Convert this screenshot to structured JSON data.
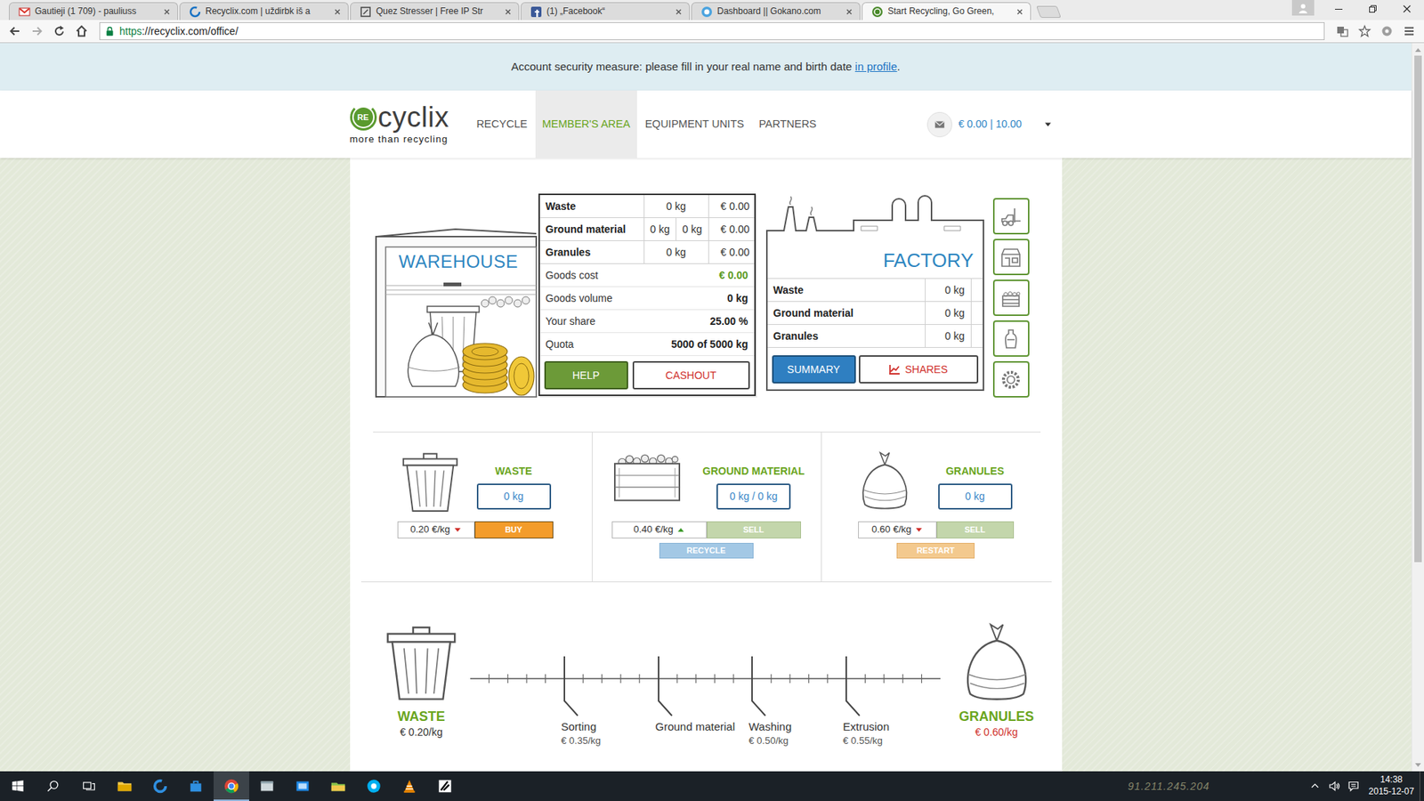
{
  "browser": {
    "tabs": [
      {
        "label": "Gautieji (1 709) - pauliuss",
        "kind": "gmail",
        "selected": false
      },
      {
        "label": "Recyclix.com | uždirbk iš a",
        "kind": "recyclix",
        "selected": false
      },
      {
        "label": "Quez Stresser | Free IP Str",
        "kind": "page",
        "selected": false
      },
      {
        "label": "(1) „Facebook“",
        "kind": "facebook",
        "selected": false
      },
      {
        "label": "Dashboard || Gokano.com",
        "kind": "gokano",
        "selected": false
      },
      {
        "label": "Start Recycling, Go Green,",
        "kind": "recyclixgreen",
        "selected": true
      }
    ],
    "url": {
      "scheme": "https",
      "rest": "://recyclix.com/office/"
    }
  },
  "scrollbar": {
    "level": 0.72
  },
  "notice": {
    "text": "Account security measure: please fill in your real name and birth date ",
    "link": "in profile",
    "end": "."
  },
  "logo": {
    "badge": "RE",
    "word": "cyclix",
    "tagline": "more than recycling"
  },
  "nav": [
    {
      "label": "RECYCLE",
      "selected": false
    },
    {
      "label": "MEMBER'S AREA",
      "selected": true
    },
    {
      "label": "EQUIPMENT UNITS",
      "selected": false
    },
    {
      "label": "PARTNERS",
      "selected": false
    }
  ],
  "balance": "€ 0.00 | 10.00",
  "warehouse": {
    "title": "WAREHOUSE",
    "goods": [
      {
        "name": "Waste",
        "cells": [
          "0 kg",
          "€ 0.00"
        ]
      },
      {
        "name": "Ground material",
        "cells": [
          "0 kg",
          "0 kg",
          "€ 0.00"
        ]
      },
      {
        "name": "Granules",
        "cells": [
          "0 kg",
          "€ 0.00"
        ]
      }
    ],
    "summary": [
      {
        "label": "Goods cost",
        "value": "€ 0.00",
        "color": "#5b9a1e"
      },
      {
        "label": "Goods volume",
        "value": "0 kg",
        "color": "#222222"
      },
      {
        "label": "Your share",
        "value": "25.00 %",
        "color": "#222222"
      },
      {
        "label": "Quota",
        "value": "5000 of 5000 kg",
        "color": "#222222"
      }
    ],
    "buttons": [
      {
        "label": "HELP",
        "kind": "help"
      },
      {
        "label": "CASHOUT",
        "kind": "cashout"
      }
    ]
  },
  "factory": {
    "title": "FACTORY",
    "rows": [
      {
        "name": "Waste",
        "value": "0 kg"
      },
      {
        "name": "Ground material",
        "value": "0 kg"
      },
      {
        "name": "Granules",
        "value": "0 kg"
      }
    ],
    "buttons": [
      {
        "label": "SUMMARY",
        "kind": "summary"
      },
      {
        "label": "SHARES",
        "kind": "shares"
      }
    ]
  },
  "market": [
    {
      "title": "WASTE",
      "kind": "waste",
      "amount": "0 kg",
      "price": "0.20 €/kg",
      "trend": "down",
      "color": "#d0312d",
      "action": {
        "label": "BUY",
        "kind": "buy",
        "disabled": false
      }
    },
    {
      "title": "GROUND MATERIAL",
      "kind": "ground",
      "amount": "0 kg / 0 kg",
      "price": "0.40 €/kg",
      "trend": "up",
      "color": "#3c9a2a",
      "action": {
        "label": "SELL",
        "kind": "sell",
        "disabled": true
      },
      "extra": {
        "label": "RECYCLE",
        "kind": "recycle",
        "disabled": true
      }
    },
    {
      "title": "GRANULES",
      "kind": "granules",
      "amount": "0 kg",
      "price": "0.60 €/kg",
      "trend": "down",
      "color": "#d0312d",
      "action": {
        "label": "SELL",
        "kind": "sell",
        "disabled": true
      },
      "extra": {
        "label": "RESTART",
        "kind": "restart",
        "disabled": true
      }
    }
  ],
  "process": {
    "start": {
      "label": "WASTE",
      "price": "€ 0.20/kg"
    },
    "steps": [
      {
        "label": "Sorting",
        "price": "€ 0.35/kg"
      },
      {
        "label": "Ground material"
      },
      {
        "label": "Washing",
        "price": "€ 0.50/kg"
      },
      {
        "label": "Extrusion",
        "price": "€ 0.55/kg"
      }
    ],
    "end": {
      "label": "GRANULES",
      "price": "€ 0.60/kg"
    }
  },
  "taskbar": {
    "apps": [
      {
        "kind": "explorer",
        "selected": false
      },
      {
        "kind": "edge",
        "selected": false
      },
      {
        "kind": "store",
        "selected": false
      },
      {
        "kind": "chrome",
        "selected": true
      },
      {
        "kind": "window",
        "selected": false
      },
      {
        "kind": "mail",
        "selected": false
      },
      {
        "kind": "folder",
        "selected": false
      },
      {
        "kind": "skype",
        "selected": false
      },
      {
        "kind": "vlc",
        "selected": false
      },
      {
        "kind": "pen",
        "selected": false
      }
    ],
    "watermark": "91.211.245.204",
    "time": "14:38",
    "date": "2015-12-07"
  }
}
